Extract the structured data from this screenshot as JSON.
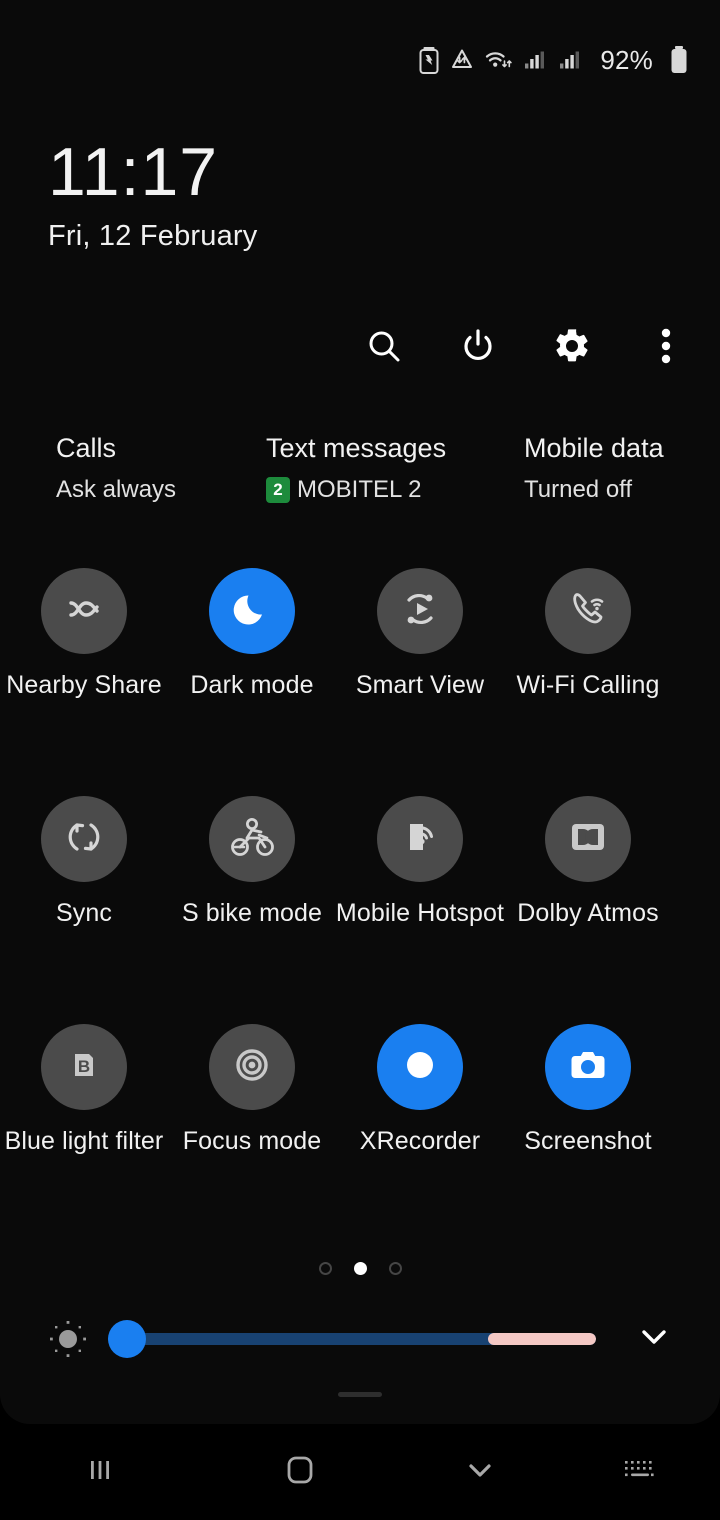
{
  "statusbar": {
    "icons": [
      "battery-saver-icon",
      "data-saver-icon",
      "wifi-transfer-icon",
      "signal-sim1-icon",
      "signal-sim2-icon"
    ],
    "battery_percent": "92%",
    "battery_icon": "battery-full-icon"
  },
  "clock": {
    "time": "11:17",
    "date": "Fri, 12 February"
  },
  "header_tools": [
    {
      "name": "search-button",
      "icon": "search-icon"
    },
    {
      "name": "power-button",
      "icon": "power-icon"
    },
    {
      "name": "settings-button",
      "icon": "gear-icon"
    },
    {
      "name": "more-options-button",
      "icon": "three-dot-menu-icon"
    }
  ],
  "sim_summary": [
    {
      "title": "Calls",
      "value": "Ask always",
      "badge": ""
    },
    {
      "title": "Text messages",
      "value": "MOBITEL 2",
      "badge": "2"
    },
    {
      "title": "Mobile data",
      "value": "Turned off",
      "badge": ""
    }
  ],
  "tiles": [
    [
      {
        "label": "Nearby Share",
        "icon": "nearby-share-icon",
        "active": false
      },
      {
        "label": "Dark mode",
        "icon": "moon-icon",
        "active": true
      },
      {
        "label": "Smart View",
        "icon": "smart-view-icon",
        "active": false
      },
      {
        "label": "Wi-Fi Calling",
        "icon": "wifi-calling-icon",
        "active": false
      }
    ],
    [
      {
        "label": "Sync",
        "icon": "sync-icon",
        "active": false
      },
      {
        "label": "S bike mode",
        "icon": "motorcycle-icon",
        "active": false
      },
      {
        "label": "Mobile Hotspot",
        "icon": "hotspot-icon",
        "active": false
      },
      {
        "label": "Dolby Atmos",
        "icon": "dolby-icon",
        "active": false
      }
    ],
    [
      {
        "label": "Blue light filter",
        "icon": "blue-light-filter-icon",
        "active": false
      },
      {
        "label": "Focus mode",
        "icon": "focus-mode-icon",
        "active": false
      },
      {
        "label": "XRecorder",
        "icon": "record-circle-icon",
        "active": true
      },
      {
        "label": "Screenshot",
        "icon": "camera-icon",
        "active": true
      }
    ]
  ],
  "pager": {
    "total": 3,
    "active_index": 1
  },
  "brightness": {
    "auto_icon": "brightness-auto-icon",
    "value_percent": 3,
    "expand_icon": "chevron-down-icon"
  },
  "navbar": [
    {
      "name": "recents-button",
      "icon": "recents-icon"
    },
    {
      "name": "home-button",
      "icon": "home-icon"
    },
    {
      "name": "hide-panel-button",
      "icon": "chevron-down-icon"
    },
    {
      "name": "keyboard-button",
      "icon": "keyboard-icon"
    }
  ],
  "colors": {
    "accent_blue": "#1a7ff0",
    "tile_off": "#4b4b4b",
    "badge_green": "#1d8b3c",
    "slider_track": "#184272",
    "slider_tail": "#f4c8c4",
    "panel_bg": "#0a0a0a"
  }
}
